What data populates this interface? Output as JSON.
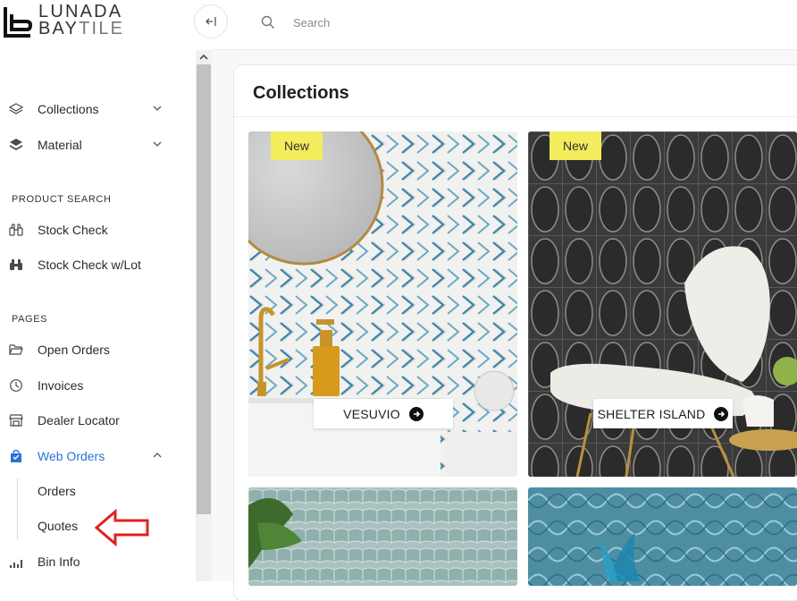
{
  "brand": {
    "line1": "LUNADA",
    "line2a": "BAY",
    "line2b": "TILE"
  },
  "search": {
    "placeholder": "Search"
  },
  "nav": {
    "collections": "Collections",
    "material": "Material",
    "section_product_search": "PRODUCT SEARCH",
    "stock_check": "Stock Check",
    "stock_check_lot": "Stock Check w/Lot",
    "section_pages": "PAGES",
    "open_orders": "Open Orders",
    "invoices": "Invoices",
    "dealer_locator": "Dealer Locator",
    "web_orders": "Web Orders",
    "orders": "Orders",
    "quotes": "Quotes",
    "bin_info": "Bin Info"
  },
  "main": {
    "title": "Collections",
    "tiles": [
      {
        "badge": "New",
        "label": "VESUVIO"
      },
      {
        "badge": "New",
        "label": "SHELTER ISLAND"
      },
      {
        "badge": "",
        "label": ""
      },
      {
        "badge": "",
        "label": ""
      }
    ]
  },
  "colors": {
    "accent": "#2a73d4",
    "badge": "#f3ec5c",
    "annotation": "#e02020"
  }
}
